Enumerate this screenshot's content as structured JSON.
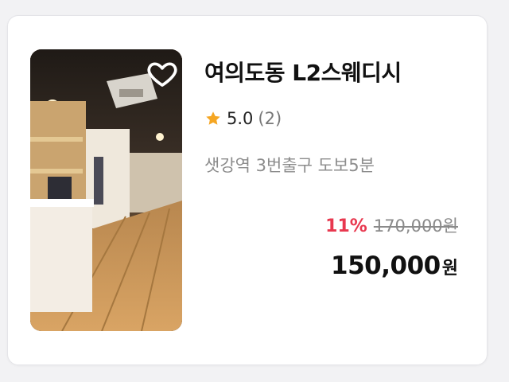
{
  "listing": {
    "title": "여의도동 L2스웨디시",
    "rating": "5.0",
    "review_count": "(2)",
    "location": "샛강역 3번출구 도보5분",
    "discount": "11%",
    "original_price": "170,000원",
    "sale_price": "150,000",
    "sale_unit": "원",
    "image_icon": "interior-photo",
    "favorite_icon": "heart-outline-icon",
    "star_icon": "star-icon",
    "colors": {
      "discount": "#e8384f",
      "star": "#f5a623",
      "title": "#111111",
      "muted": "#8c8c8c"
    }
  }
}
